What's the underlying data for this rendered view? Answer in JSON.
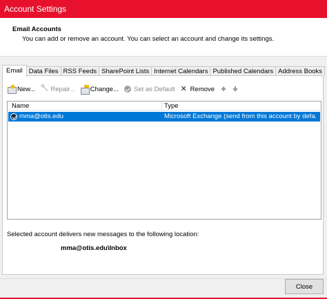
{
  "window": {
    "title": "Account Settings",
    "accent_color": "#e8112d"
  },
  "header": {
    "title": "Email Accounts",
    "description": "You can add or remove an account. You can select an account and change its settings."
  },
  "tabs": [
    {
      "label": "Email",
      "active": true
    },
    {
      "label": "Data Files"
    },
    {
      "label": "RSS Feeds"
    },
    {
      "label": "SharePoint Lists"
    },
    {
      "label": "Internet Calendars"
    },
    {
      "label": "Published Calendars"
    },
    {
      "label": "Address Books"
    }
  ],
  "toolbar": {
    "new_label": "New...",
    "repair_label": "Repair...",
    "change_label": "Change...",
    "set_default_label": "Set as Default",
    "remove_label": "Remove",
    "icons": [
      "new-account-icon",
      "repair-icon",
      "change-icon",
      "set-default-icon",
      "remove-icon",
      "move-up-icon",
      "move-down-icon"
    ]
  },
  "accounts": {
    "columns": {
      "name": "Name",
      "type": "Type"
    },
    "rows": [
      {
        "name": "mma@otis.edu",
        "type": "Microsoft Exchange (send from this account by defa...",
        "selected": true,
        "default": true
      }
    ],
    "selection_color": "#0078d7"
  },
  "delivery": {
    "text": "Selected account delivers new messages to the following location:",
    "location": "mma@otis.edu\\Inbox"
  },
  "footer": {
    "close_label": "Close"
  }
}
